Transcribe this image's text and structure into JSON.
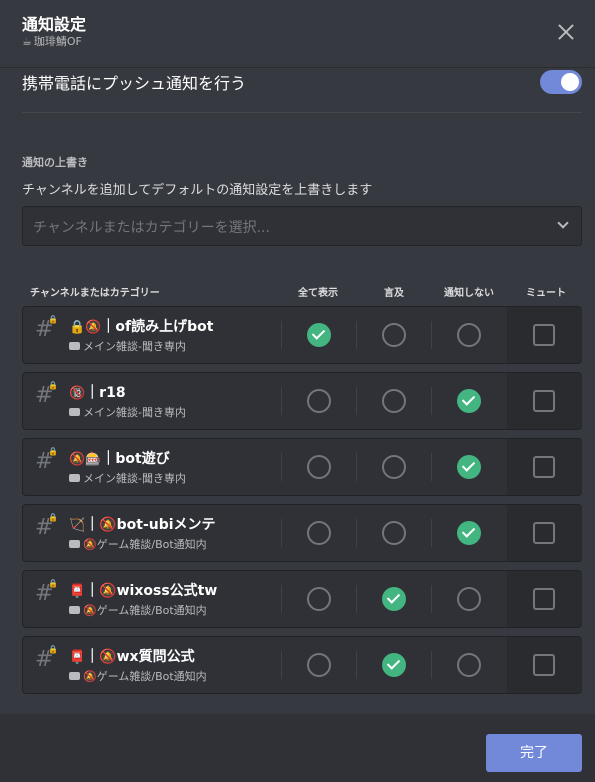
{
  "header": {
    "title": "通知設定",
    "server_icon": "☕",
    "server_name": "珈琲鯖OF",
    "close_icon": "close-icon"
  },
  "push": {
    "label": "携帯電話にプッシュ通知を行う",
    "enabled": true
  },
  "override": {
    "section_title": "通知の上書き",
    "description": "チャンネルを追加してデフォルトの通知設定を上書きします",
    "select_placeholder": "チャンネルまたはカテゴリーを選択..."
  },
  "columns": {
    "channel": "チャンネルまたはカテゴリー",
    "all": "全て表示",
    "mentions": "言及",
    "nothing": "通知しない",
    "mute": "ミュート"
  },
  "rows": [
    {
      "icons": "🔒🔕",
      "name": "｜of読み上げbot",
      "category": "メイン雑談-聞き専内",
      "cat_icon": "",
      "selected": "all",
      "muted": false
    },
    {
      "icons": "🔞",
      "name": "｜r18",
      "category": "メイン雑談-聞き専内",
      "cat_icon": "",
      "selected": "nothing",
      "muted": false
    },
    {
      "icons": "🔕🎰",
      "name": "｜bot遊び",
      "category": "メイン雑談-聞き専内",
      "cat_icon": "",
      "selected": "nothing",
      "muted": false
    },
    {
      "icons": "🏹",
      "name": "｜🔕bot-ubiメンテ",
      "category": "ゲーム雑談/Bot通知内",
      "cat_icon": "🔕",
      "selected": "nothing",
      "muted": false
    },
    {
      "icons": "📮",
      "name": "｜🔕wixoss公式tw",
      "category": "ゲーム雑談/Bot通知内",
      "cat_icon": "🔕",
      "selected": "mentions",
      "muted": false
    },
    {
      "icons": "📮",
      "name": "｜🔕wx質問公式",
      "category": "ゲーム雑談/Bot通知内",
      "cat_icon": "🔕",
      "selected": "mentions",
      "muted": false
    }
  ],
  "footer": {
    "done_label": "完了"
  },
  "colors": {
    "accent": "#7289da",
    "checked": "#43b581",
    "background": "#36393f"
  }
}
